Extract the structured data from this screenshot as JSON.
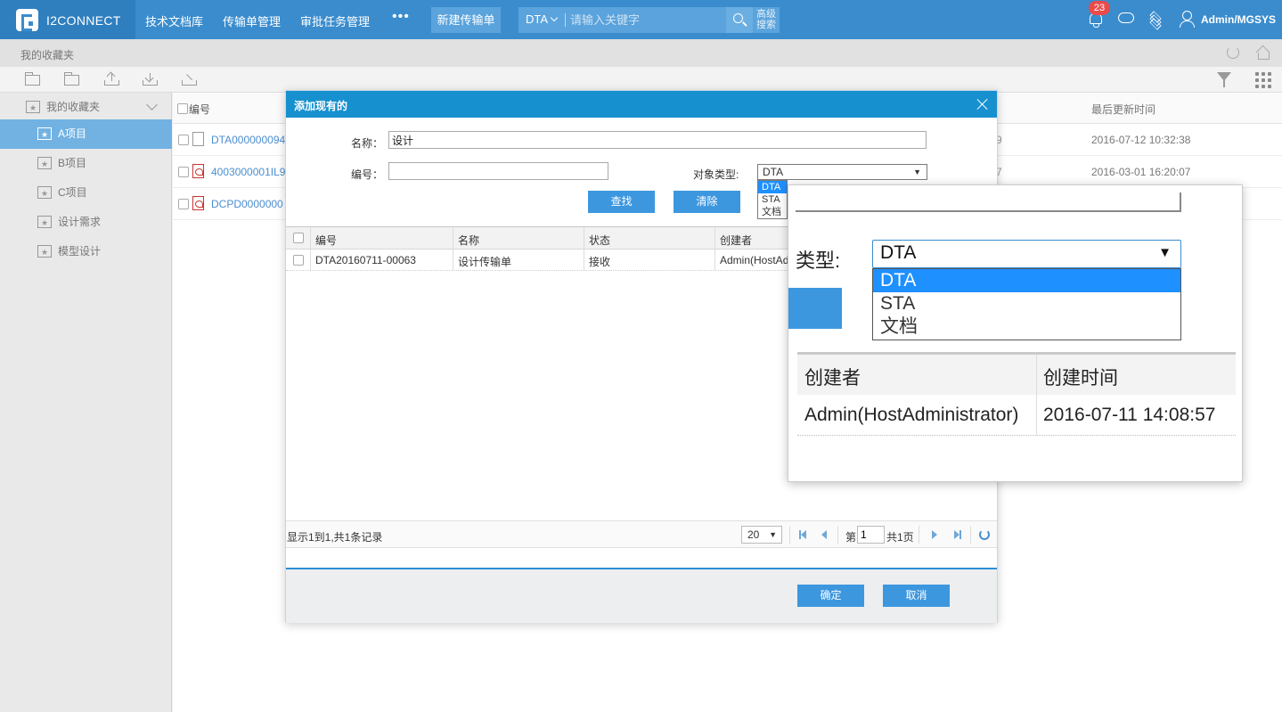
{
  "header": {
    "app_name": "I2CONNECT",
    "nav": [
      "技术文档库",
      "传输单管理",
      "审批任务管理"
    ],
    "more": "•••",
    "new_button": "新建传输单",
    "search_type": "DTA",
    "search_placeholder": "请输入关键字",
    "advanced_search": "高级搜索",
    "notification_count": "23",
    "user": "Admin/MGSYS"
  },
  "breadcrumb": "我的收藏夹",
  "sidebar": {
    "root": "我的收藏夹",
    "items": [
      "A项目",
      "B项目",
      "C项目",
      "设计需求",
      "模型设计"
    ],
    "active_index": 0
  },
  "list": {
    "col_number": "编号",
    "col_updated": "最后更新时间",
    "rows": [
      {
        "number": "DTA000000094",
        "suffix": "9",
        "updated": "2016-07-12 10:32:38",
        "icon": "document-icon"
      },
      {
        "number": "4003000001IL9",
        "suffix": "7",
        "updated": "2016-03-01 16:20:07",
        "icon": "pdf-icon"
      },
      {
        "number": "DCPD0000000",
        "suffix": "",
        "updated": "",
        "icon": "pdf-icon"
      }
    ]
  },
  "dialog": {
    "title": "添加现有的",
    "name_label": "名称：",
    "name_value": "设计",
    "number_label": "编号：",
    "number_value": "",
    "type_label": "对象类型:",
    "type_value": "DTA",
    "type_options": [
      "DTA",
      "STA",
      "文档"
    ],
    "search_button": "查找",
    "clear_button": "清除",
    "columns": [
      "编号",
      "名称",
      "状态",
      "创建者"
    ],
    "rows": [
      {
        "number": "DTA20160711-00063",
        "name": "设计传输单",
        "status": "接收",
        "creator": "Admin(HostAdministrator)"
      }
    ],
    "pager_text": "显示1到1,共1条记录",
    "page_size": "20",
    "page_label": "第",
    "page_value": "1",
    "page_total": "共1页",
    "ok_button": "确定",
    "cancel_button": "取消"
  },
  "zoom": {
    "type_label": "类型:",
    "type_value": "DTA",
    "options": [
      "DTA",
      "STA",
      "文档"
    ],
    "col_creator": "创建者",
    "col_created": "创建时间",
    "creator": "Admin(HostAdministrator)",
    "created": "2016-07-11 14:08:57"
  },
  "colors": {
    "header_bg": "#3a8ccd",
    "accent": "#3c97df",
    "dialog_header": "#1790d0",
    "badge": "#e94b4b",
    "link": "#4a8ed0"
  }
}
